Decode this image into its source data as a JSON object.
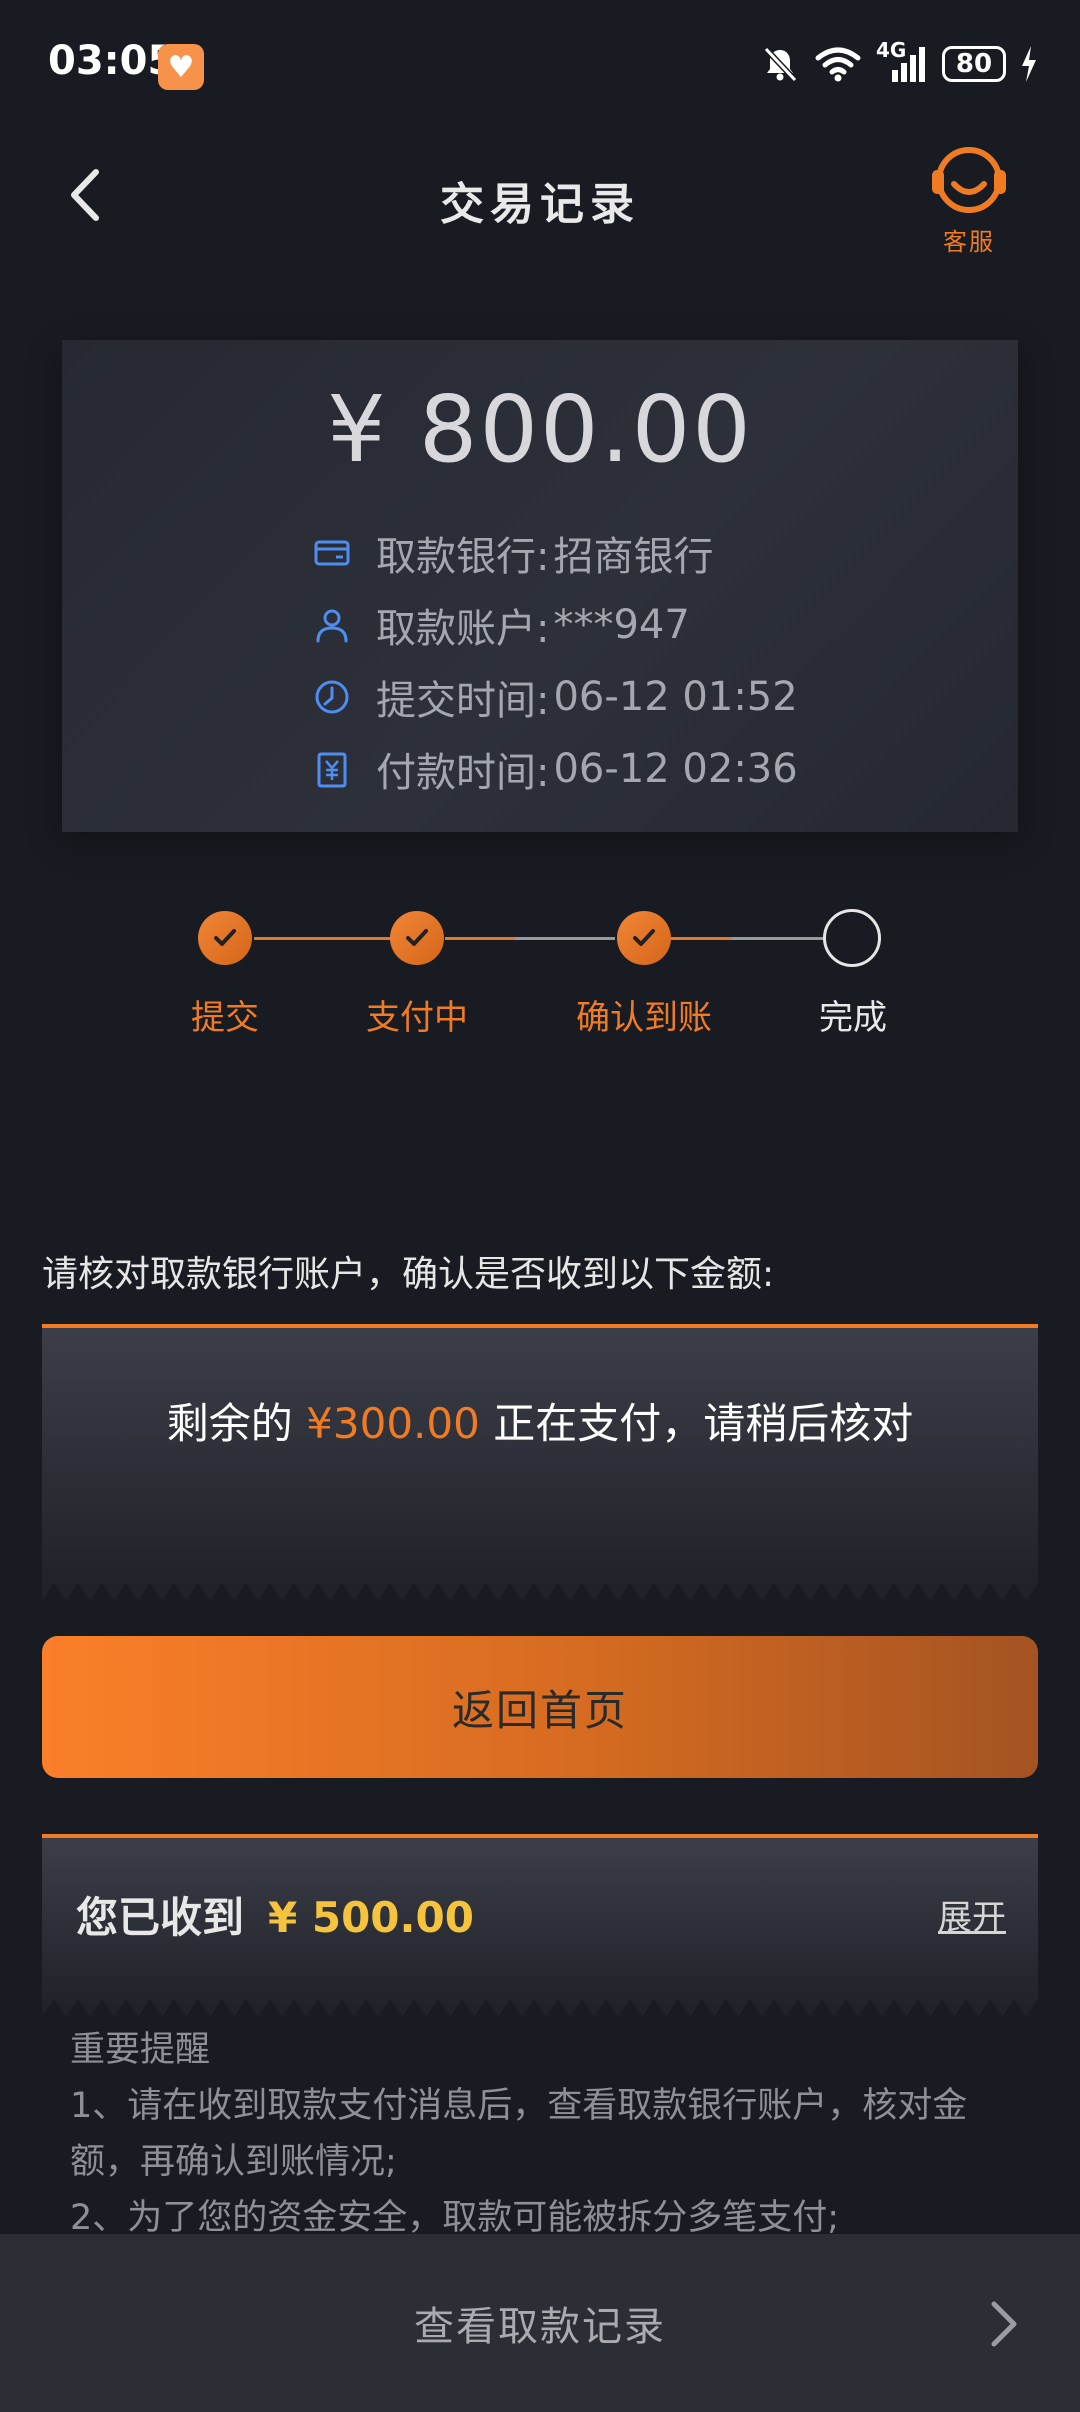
{
  "status_bar": {
    "time": "03:05",
    "network": "4G",
    "battery": "80",
    "icons": [
      "heart-app-icon",
      "silent-bell-icon",
      "wifi-icon",
      "signal-icon",
      "battery-icon",
      "charging-icon"
    ]
  },
  "header": {
    "title": "交易记录",
    "service_label": "客服"
  },
  "amount_card": {
    "amount": "¥ 800.00",
    "rows": [
      {
        "icon": "card-icon",
        "label": "取款银行:",
        "value": "招商银行"
      },
      {
        "icon": "user-icon",
        "label": "取款账户:",
        "value": "***947"
      },
      {
        "icon": "clock-icon",
        "label": "提交时间:",
        "value": "06-12 01:52"
      },
      {
        "icon": "receipt-yen-icon",
        "label": "付款时间:",
        "value": "06-12 02:36"
      }
    ]
  },
  "progress": {
    "steps": [
      {
        "label": "提交",
        "done": true
      },
      {
        "label": "支付中",
        "done": true
      },
      {
        "label": "确认到账",
        "done": true
      },
      {
        "label": "完成",
        "done": false
      }
    ]
  },
  "prompt": "请核对取款银行账户，确认是否收到以下金额:",
  "pending": {
    "prefix": "剩余的",
    "amount": "¥300.00",
    "suffix": "正在支付，请稍后核对"
  },
  "home_button": "返回首页",
  "received": {
    "label": "您已收到",
    "amount": "¥ 500.00",
    "expand": "展开"
  },
  "notes": {
    "title": "重要提醒",
    "item1": "1、请在收到取款支付消息后，查看取款银行账户，核对金额，再确认到账情况;",
    "item2": "2、为了您的资金安全，取款可能被拆分多笔支付;"
  },
  "bottom_bar": {
    "label": "查看取款记录"
  },
  "colors": {
    "accent": "#f07b22",
    "gold": "#f5c33c",
    "background": "#191b22",
    "card": "#2a2d35"
  }
}
